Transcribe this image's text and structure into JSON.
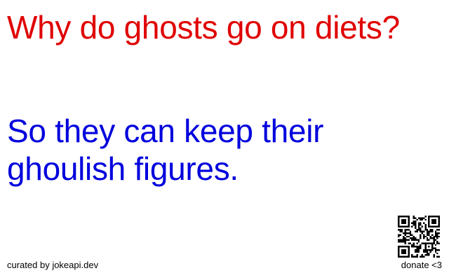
{
  "joke": {
    "setup": "Why do ghosts go on diets?",
    "delivery": "So they can keep their ghoulish figures."
  },
  "footer": {
    "credit": "curated by jokeapi.dev",
    "donate": "donate <3"
  },
  "colors": {
    "setup": "#e00000",
    "delivery": "#0000dd",
    "background": "#ffffff"
  },
  "icons": {
    "qr": "qr-code-icon"
  }
}
